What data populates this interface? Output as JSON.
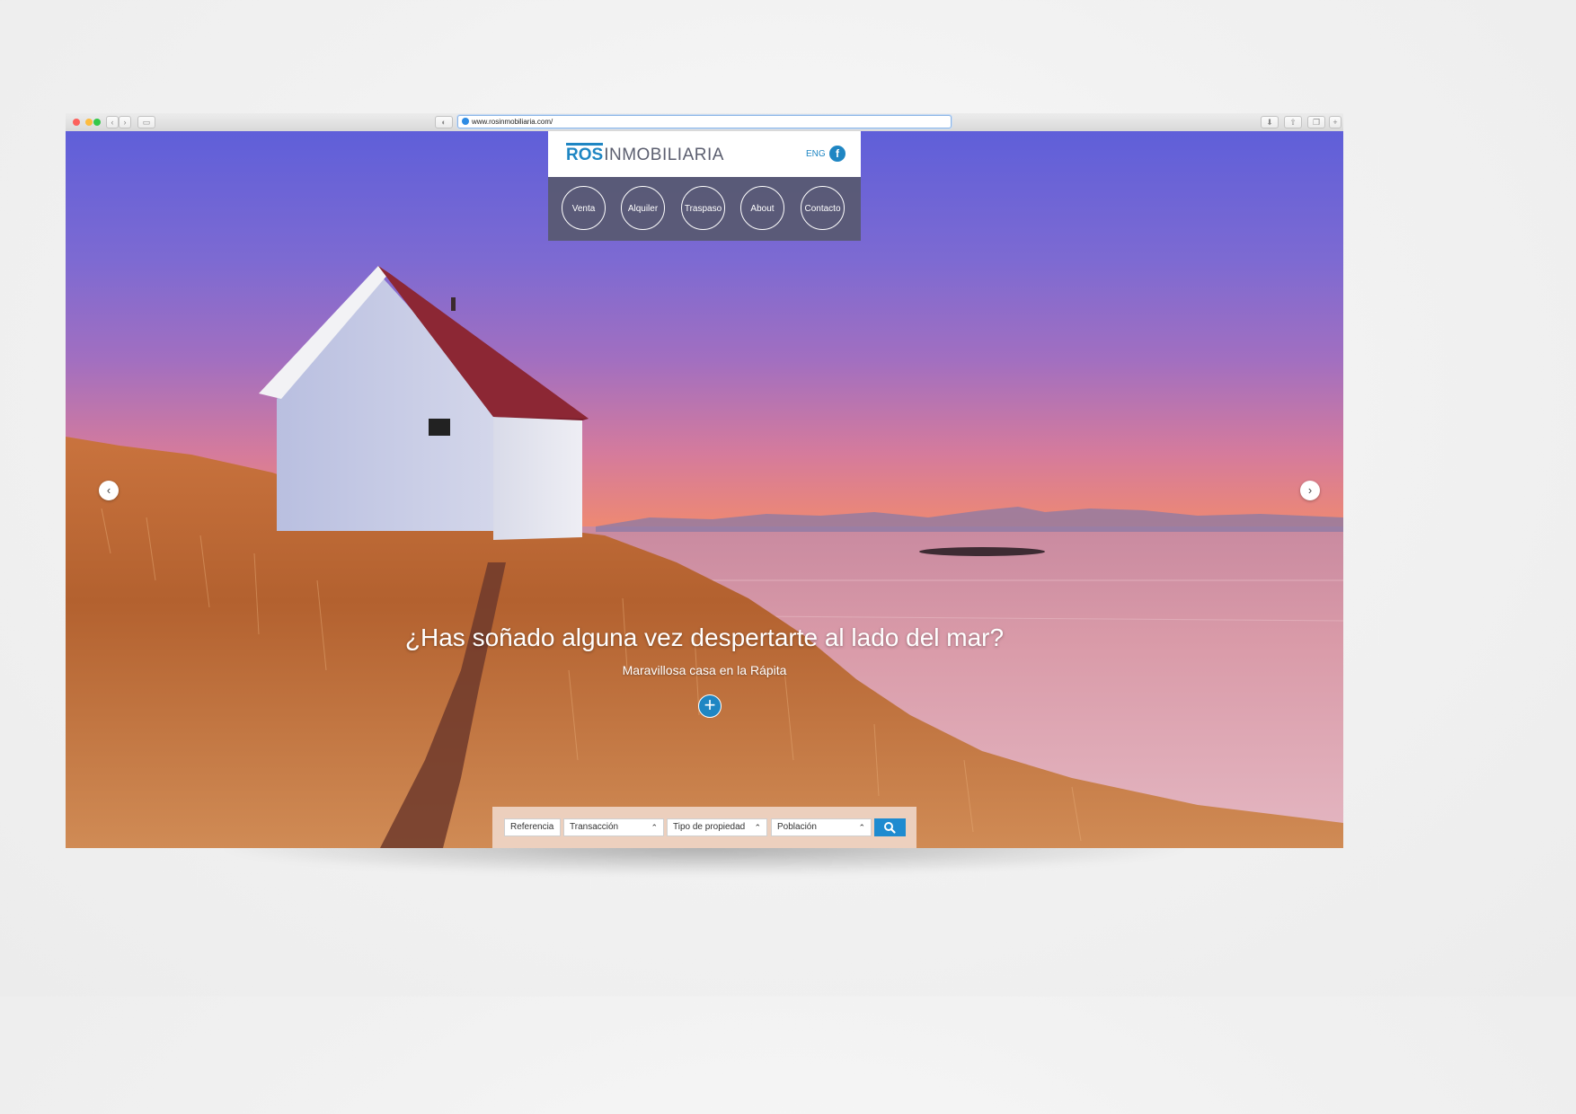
{
  "browser": {
    "url": "www.rosinmobiliaria.com/"
  },
  "brand": {
    "name_bold": "ROS",
    "name_light": "INMOBILIARIA",
    "lang": "ENG",
    "facebook_glyph": "f"
  },
  "nav": {
    "items": [
      {
        "label": "Venta"
      },
      {
        "label": "Alquiler"
      },
      {
        "label": "Traspaso"
      },
      {
        "label": "About"
      },
      {
        "label": "Contacto"
      }
    ]
  },
  "hero": {
    "headline": "¿Has soñado alguna vez despertarte al lado del mar?",
    "subtitle": "Maravillosa casa en la Rápita"
  },
  "search": {
    "referencia": "Referencia",
    "transaccion": "Transacción",
    "tipo": "Tipo de propiedad",
    "poblacion": "Población"
  },
  "colors": {
    "brand_blue": "#1f86c3",
    "nav_bg": "#5d5e77",
    "search_blue": "#1e8bd0"
  }
}
